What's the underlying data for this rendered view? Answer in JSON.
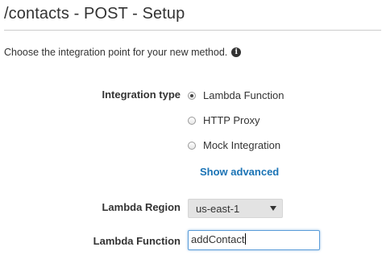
{
  "header": {
    "title": "/contacts - POST - Setup"
  },
  "intro": {
    "text": "Choose the integration point for your new method.",
    "icon": "info-icon"
  },
  "integration": {
    "label": "Integration type",
    "options": [
      {
        "label": "Lambda Function",
        "checked": true
      },
      {
        "label": "HTTP Proxy",
        "checked": false
      },
      {
        "label": "Mock Integration",
        "checked": false
      }
    ],
    "show_advanced": "Show advanced"
  },
  "region": {
    "label": "Lambda Region",
    "value": "us-east-1"
  },
  "function": {
    "label": "Lambda Function",
    "value": "addContact"
  },
  "colors": {
    "link": "#1a73b5",
    "focus_border": "#5b9dd9"
  }
}
